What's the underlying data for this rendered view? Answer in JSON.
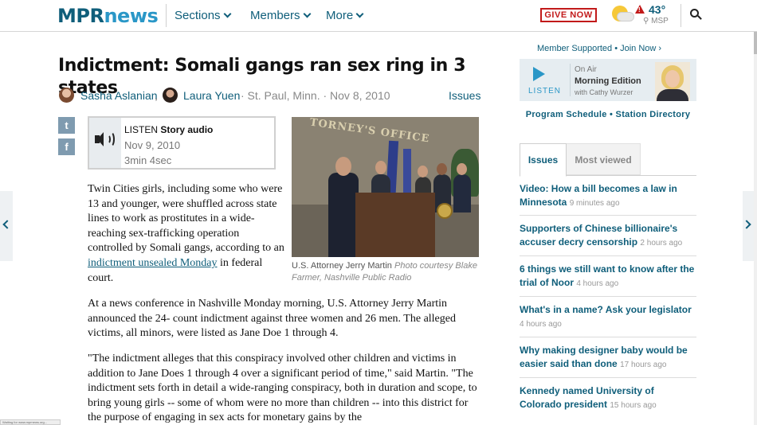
{
  "header": {
    "logo_mpr": "MPR",
    "logo_news": "news",
    "nav": [
      "Sections",
      "Members",
      "More"
    ],
    "give_now": "GIVE NOW",
    "weather": {
      "alert": "!",
      "temp": "43°",
      "location": "MSP"
    }
  },
  "article": {
    "headline": "Indictment: Somali gangs ran sex ring in 3 states",
    "authors": [
      "Sasha Aslanian",
      "Laura Yuen"
    ],
    "dateline": "· St. Paul, Minn. · Nov 8, 2010",
    "issues_link": "Issues",
    "share": {
      "twitter": "t",
      "facebook": "f"
    },
    "audio": {
      "label_prefix": "LISTEN",
      "label_bold": "Story audio",
      "date": "Nov 9, 2010",
      "duration": "3min 4sec"
    },
    "photo": {
      "sign_text": "TORNEY'S OFFICE",
      "caption": "U.S. Attorney Jerry Martin",
      "credit": "Photo courtesy Blake Farmer, Nashville Public Radio"
    },
    "p1_before": "Twin Cities girls, including some who were 13 and younger, were shuffled across state lines to work as prostitutes in a wide-reaching sex-trafficking operation controlled by Somali gangs, according to an ",
    "p1_link": "indictment unsealed Monday",
    "p1_after": " in federal court.",
    "p2": "At a news conference in Nashville Monday morning, U.S. Attorney Jerry Martin announced the 24- count indictment against three women and 26 men. The alleged victims, all minors, were listed as Jane Doe 1 through 4.",
    "p3": "\"The indictment alleges that this conspiracy involved other children and victims in addition to Jane Does 1 through 4 over a significant period of time,\" said Martin. \"The indictment sets forth in detail a wide-ranging conspiracy, both in duration and scope, to bring young girls -- some of whom were no more than children -- into this district for the purpose of engaging in sex acts for monetary gains by the"
  },
  "sidebar": {
    "member_line": "Member Supported • Join Now ›",
    "onair": {
      "listen": "LISTEN",
      "label": "On Air",
      "show": "Morning Edition",
      "host": "with Cathy Wurzer"
    },
    "schedule": "Program Schedule • Station Directory",
    "tabs": [
      "Issues",
      "Most viewed"
    ],
    "stories": [
      {
        "title": "Video: How a bill becomes a law in Minnesota",
        "time": "9 minutes ago"
      },
      {
        "title": "Supporters of Chinese billionaire's accuser decry censorship",
        "time": "2 hours ago"
      },
      {
        "title": "6 things we still want to know after the trial of Noor",
        "time": "4 hours ago"
      },
      {
        "title": "What's in a name? Ask your legislator",
        "time": "4 hours ago"
      },
      {
        "title": "Why making designer baby would be easier said than done",
        "time": "17 hours ago"
      },
      {
        "title": "Kennedy named University of Colorado president",
        "time": "15 hours ago"
      }
    ]
  },
  "status_bar": "Waiting for www.mprnews.org..."
}
